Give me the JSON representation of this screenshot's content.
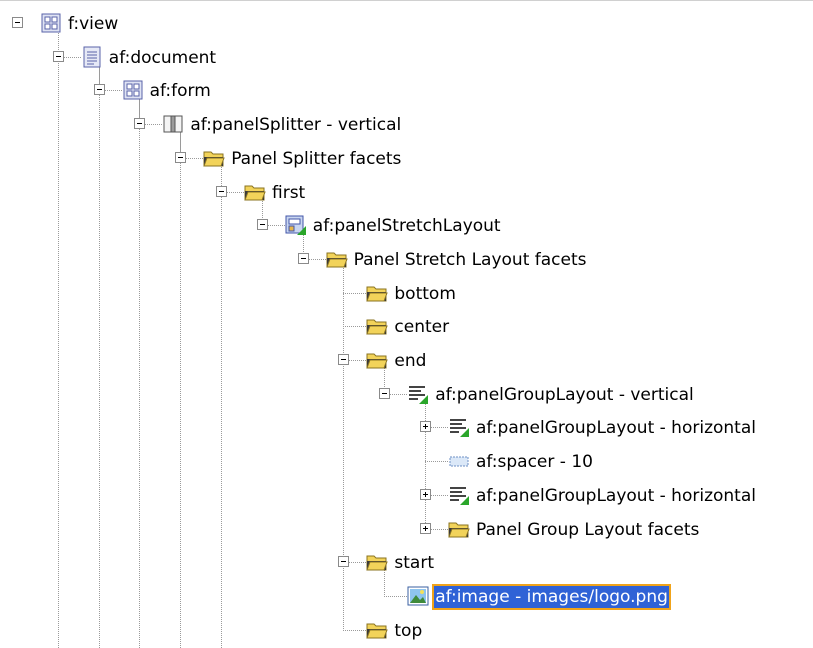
{
  "tree": {
    "nodes": [
      {
        "label": "f:view",
        "icon": "view-grid-icon",
        "toggle": "expanded"
      },
      {
        "label": "af:document",
        "icon": "document-icon",
        "toggle": "expanded"
      },
      {
        "label": "af:form",
        "icon": "form-grid-icon",
        "toggle": "expanded"
      },
      {
        "label": "af:panelSplitter - vertical",
        "icon": "panel-splitter-icon",
        "toggle": "expanded"
      },
      {
        "label": "Panel Splitter facets",
        "icon": "folder-icon",
        "toggle": "expanded"
      },
      {
        "label": "first",
        "icon": "folder-icon",
        "toggle": "expanded"
      },
      {
        "label": "af:panelStretchLayout",
        "icon": "panel-stretch-layout-icon",
        "toggle": "expanded"
      },
      {
        "label": "Panel Stretch Layout facets",
        "icon": "folder-icon",
        "toggle": "expanded"
      },
      {
        "label": "bottom",
        "icon": "folder-icon",
        "toggle": "none"
      },
      {
        "label": "center",
        "icon": "folder-icon",
        "toggle": "none"
      },
      {
        "label": "end",
        "icon": "folder-icon",
        "toggle": "expanded"
      },
      {
        "label": "af:panelGroupLayout - vertical",
        "icon": "panel-group-layout-icon",
        "toggle": "expanded"
      },
      {
        "label": "af:panelGroupLayout - horizontal",
        "icon": "panel-group-layout-icon",
        "toggle": "collapsed"
      },
      {
        "label": "af:spacer - 10",
        "icon": "spacer-icon",
        "toggle": "none"
      },
      {
        "label": "af:panelGroupLayout - horizontal",
        "icon": "panel-group-layout-icon",
        "toggle": "collapsed"
      },
      {
        "label": "Panel Group Layout facets",
        "icon": "folder-icon",
        "toggle": "collapsed"
      },
      {
        "label": "start",
        "icon": "folder-icon",
        "toggle": "expanded"
      },
      {
        "label": "af:image - images/logo.png",
        "icon": "image-icon",
        "toggle": "none",
        "selected": true
      },
      {
        "label": "top",
        "icon": "folder-icon",
        "toggle": "none"
      }
    ]
  },
  "colors": {
    "selection_bg": "#2f62d6",
    "selection_border": "#f0a31a",
    "folder_yellow": "#f2d35a",
    "badge_green": "#2aa62a"
  }
}
